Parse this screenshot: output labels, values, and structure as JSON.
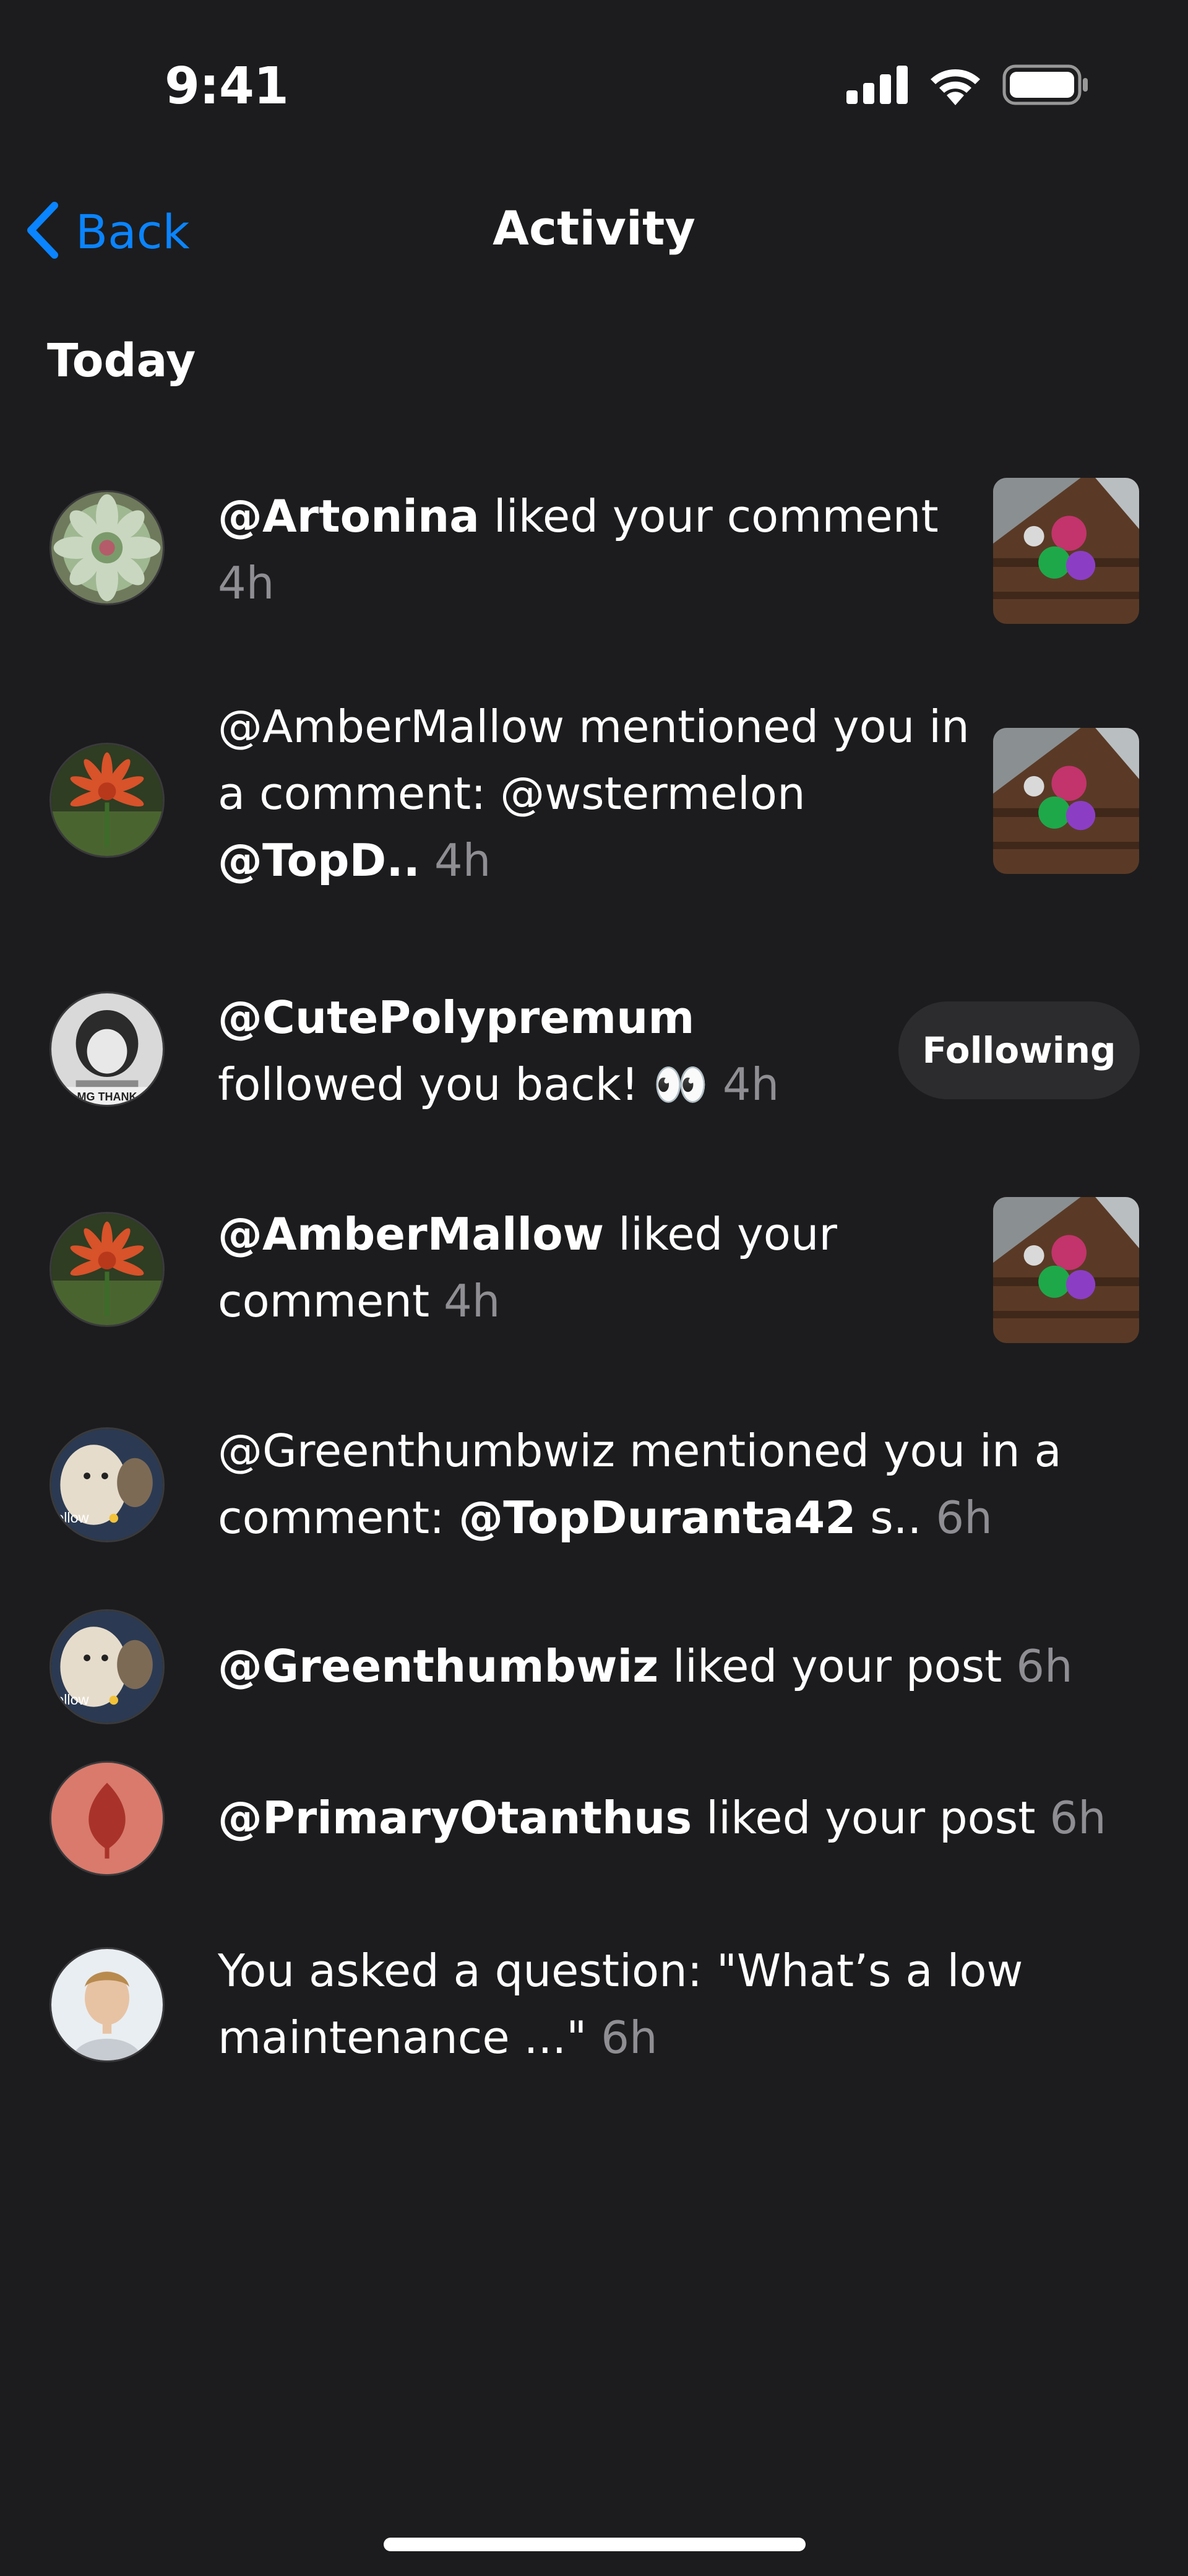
{
  "status_bar": {
    "time": "9:41",
    "signal_icon": "cellular-signal-icon",
    "wifi_icon": "wifi-icon",
    "battery_icon": "battery-icon"
  },
  "nav": {
    "back_label": "Back",
    "back_icon": "chevron-left-icon",
    "title": "Activity"
  },
  "section": {
    "title": "Today"
  },
  "activities": [
    {
      "user": "@Artonina",
      "action": " liked your comment",
      "time": "4h",
      "trailing": "thumbnail"
    },
    {
      "user_plain": "@AmberMallow mentioned you in a comment: @wstermelon ",
      "mention": "@TopD..",
      "time": "4h",
      "trailing": "thumbnail"
    },
    {
      "user": "@CutePolypremum",
      "action": "followed you back! 👀",
      "time": "4h",
      "button_label": "Following"
    },
    {
      "user": "@AmberMallow",
      "action": " liked your comment",
      "time": "4h",
      "trailing": "thumbnail"
    },
    {
      "user_plain": "@Greenthumbwiz mentioned you in a comment: ",
      "mention": "@TopDuranta42",
      "tail": " s..",
      "time": "6h"
    },
    {
      "user": "@Greenthumbwiz",
      "action": " liked your post",
      "time": "6h"
    },
    {
      "user": "@PrimaryOtanthus",
      "action": " liked your post",
      "time": "6h"
    },
    {
      "text": "You asked a question: \"What’s a low maintenance ...\"",
      "time": "6h"
    }
  ],
  "colors": {
    "background": "#1C1C1E",
    "accent": "#0A84FF",
    "secondary_text": "#8E8E93",
    "button_bg": "#2C2C2E"
  }
}
